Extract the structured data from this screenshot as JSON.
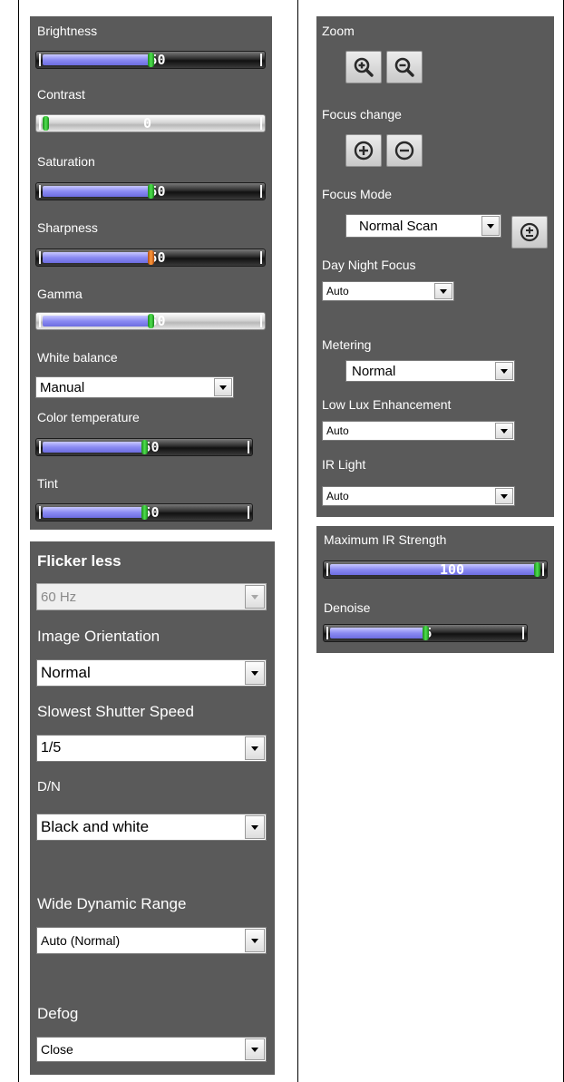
{
  "image_panel": {
    "brightness": {
      "label": "Brightness",
      "value_text": "50",
      "value": 50,
      "range": [
        0,
        100
      ]
    },
    "contrast": {
      "label": "Contrast",
      "value_text": "0",
      "value": 0,
      "range": [
        0,
        100
      ]
    },
    "saturation": {
      "label": "Saturation",
      "value_text": "50",
      "value": 50,
      "range": [
        0,
        100
      ]
    },
    "sharpness": {
      "label": "Sharpness",
      "value_text": "50",
      "value": 50,
      "range": [
        0,
        100
      ],
      "thumb_color": "#f07a28"
    },
    "gamma": {
      "label": "Gamma",
      "value_text": "50",
      "value": 50,
      "range": [
        0,
        100
      ]
    },
    "white_balance": {
      "label": "White balance",
      "selected": "Manual"
    },
    "color_temperature": {
      "label": "Color temperature",
      "value_text": "50",
      "value": 50,
      "range": [
        0,
        100
      ]
    },
    "tint": {
      "label": "Tint",
      "value_text": "50",
      "value": 50,
      "range": [
        0,
        100
      ]
    }
  },
  "exposure_panel": {
    "flicker_less": {
      "label": "Flicker less",
      "selected": "60 Hz",
      "disabled": true
    },
    "image_orientation": {
      "label": "Image Orientation",
      "selected": "Normal"
    },
    "slowest_shutter_speed": {
      "label": "Slowest Shutter Speed",
      "selected": "1/5"
    },
    "dn": {
      "label": "D/N",
      "selected": "Black and white"
    },
    "wide_dynamic_range": {
      "label": "Wide Dynamic Range",
      "selected": "Auto (Normal)"
    },
    "defog": {
      "label": "Defog",
      "selected": "Close"
    }
  },
  "lens_panel": {
    "zoom": {
      "label": "Zoom",
      "zoom_in_icon": "zoom-in-icon",
      "zoom_out_icon": "zoom-out-icon"
    },
    "focus_change": {
      "label": "Focus change",
      "focus_near_icon": "focus-plus-icon",
      "focus_far_icon": "focus-minus-icon"
    },
    "focus_mode": {
      "label": "Focus Mode",
      "selected": "Normal Scan",
      "button_icon": "one-push-focus-icon"
    },
    "day_night_focus": {
      "label": "Day Night Focus",
      "selected": "Auto"
    },
    "metering": {
      "label": "Metering",
      "selected": "Normal"
    },
    "low_lux_enhancement": {
      "label": "Low Lux Enhancement",
      "selected": "Auto"
    },
    "ir_light": {
      "label": "IR Light",
      "selected": "Auto"
    }
  },
  "ir_panel": {
    "maximum_ir_strength": {
      "label": "Maximum IR Strength",
      "value_text": "100",
      "value": 100,
      "range": [
        0,
        100
      ]
    },
    "denoise": {
      "label": "Denoise",
      "value_text": "5",
      "value": 50,
      "range": [
        0,
        100
      ]
    }
  },
  "colors": {
    "panel_bg": "#5a5a5a",
    "slider_fill": "#8b8bf2",
    "thumb_green": "#35c835",
    "thumb_orange": "#f07a28"
  }
}
